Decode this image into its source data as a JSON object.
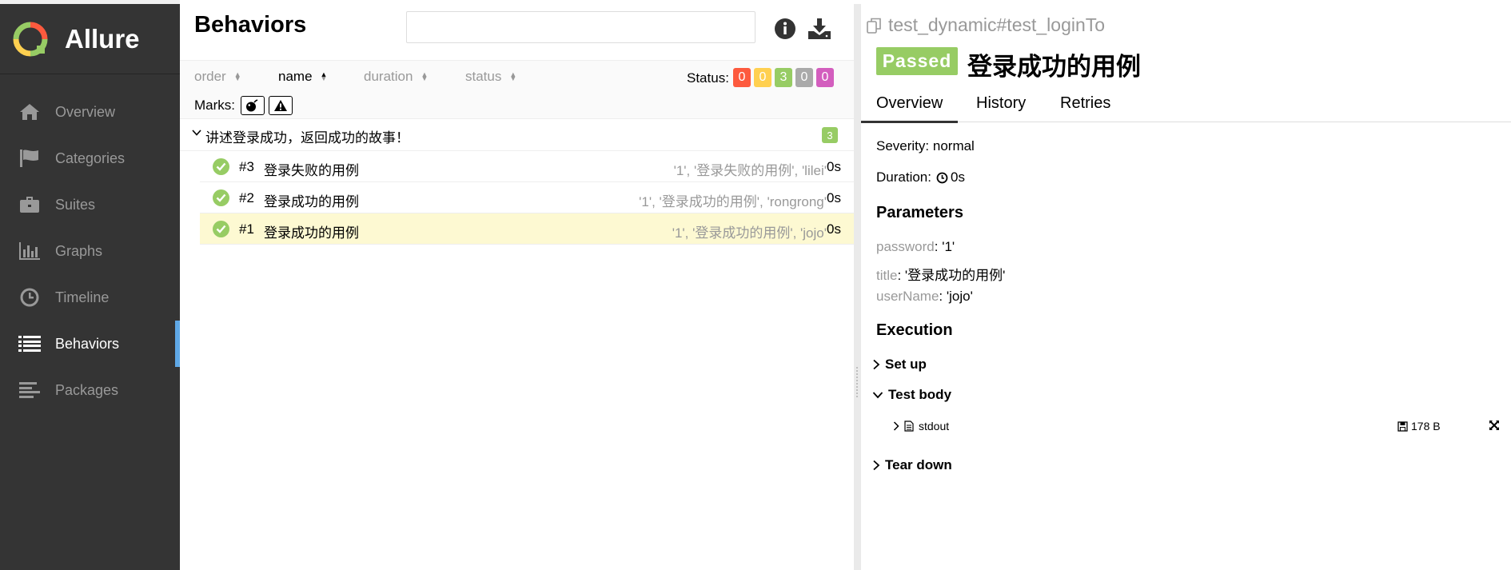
{
  "brand": {
    "name": "Allure",
    "colors": {
      "red": "#fd5a3e",
      "orange": "#ffd050",
      "green": "#97cc64",
      "blue": "#5fa8e6"
    }
  },
  "sidebar": {
    "items": [
      {
        "label": "Overview",
        "icon": "home-icon",
        "active": false
      },
      {
        "label": "Categories",
        "icon": "flag-icon",
        "active": false
      },
      {
        "label": "Suites",
        "icon": "briefcase-icon",
        "active": false
      },
      {
        "label": "Graphs",
        "icon": "bar-chart-icon",
        "active": false
      },
      {
        "label": "Timeline",
        "icon": "clock-icon",
        "active": false
      },
      {
        "label": "Behaviors",
        "icon": "list-icon",
        "active": true
      },
      {
        "label": "Packages",
        "icon": "align-left-icon",
        "active": false
      }
    ]
  },
  "behaviors": {
    "title": "Behaviors",
    "search": {
      "value": "",
      "placeholder": ""
    },
    "sort": {
      "order": "order",
      "name": "name",
      "duration": "duration",
      "status": "status",
      "active": "name"
    },
    "status_label": "Status:",
    "status_counts": [
      {
        "value": "0",
        "color": "#fd5a3e",
        "status": "failed"
      },
      {
        "value": "0",
        "color": "#ffd050",
        "status": "broken"
      },
      {
        "value": "3",
        "color": "#97cc64",
        "status": "passed"
      },
      {
        "value": "0",
        "color": "#aaaaaa",
        "status": "skipped"
      },
      {
        "value": "0",
        "color": "#d35ebe",
        "status": "unknown"
      }
    ],
    "marks_label": "Marks:",
    "group": {
      "label": "讲述登录成功，返回成功的故事！",
      "count": "3"
    },
    "tests": [
      {
        "num": "#3",
        "name": "登录失败的用例",
        "params": "'1', '登录失败的用例', 'lilei'",
        "duration": "0s",
        "selected": false
      },
      {
        "num": "#2",
        "name": "登录成功的用例",
        "params": "'1', '登录成功的用例', 'rongrong'",
        "duration": "0s",
        "selected": false
      },
      {
        "num": "#1",
        "name": "登录成功的用例",
        "params": "'1', '登录成功的用例', 'jojo'",
        "duration": "0s",
        "selected": true
      }
    ]
  },
  "detail": {
    "full_name": "test_dynamic#test_loginTo",
    "status": "Passed",
    "title": "登录成功的用例",
    "tabs": [
      "Overview",
      "History",
      "Retries"
    ],
    "severity_label": "Severity:",
    "severity": "normal",
    "duration_label": "Duration:",
    "duration": "0s",
    "parameters_title": "Parameters",
    "parameters": [
      {
        "key": "password",
        "value": "'1'"
      },
      {
        "key": "title",
        "value": "'登录成功的用例'"
      },
      {
        "key": "userName",
        "value": "'jojo'"
      }
    ],
    "execution_title": "Execution",
    "setup": "Set up",
    "body": "Test body",
    "attachment": {
      "name": "stdout",
      "size": "178 B"
    },
    "teardown": "Tear down"
  }
}
